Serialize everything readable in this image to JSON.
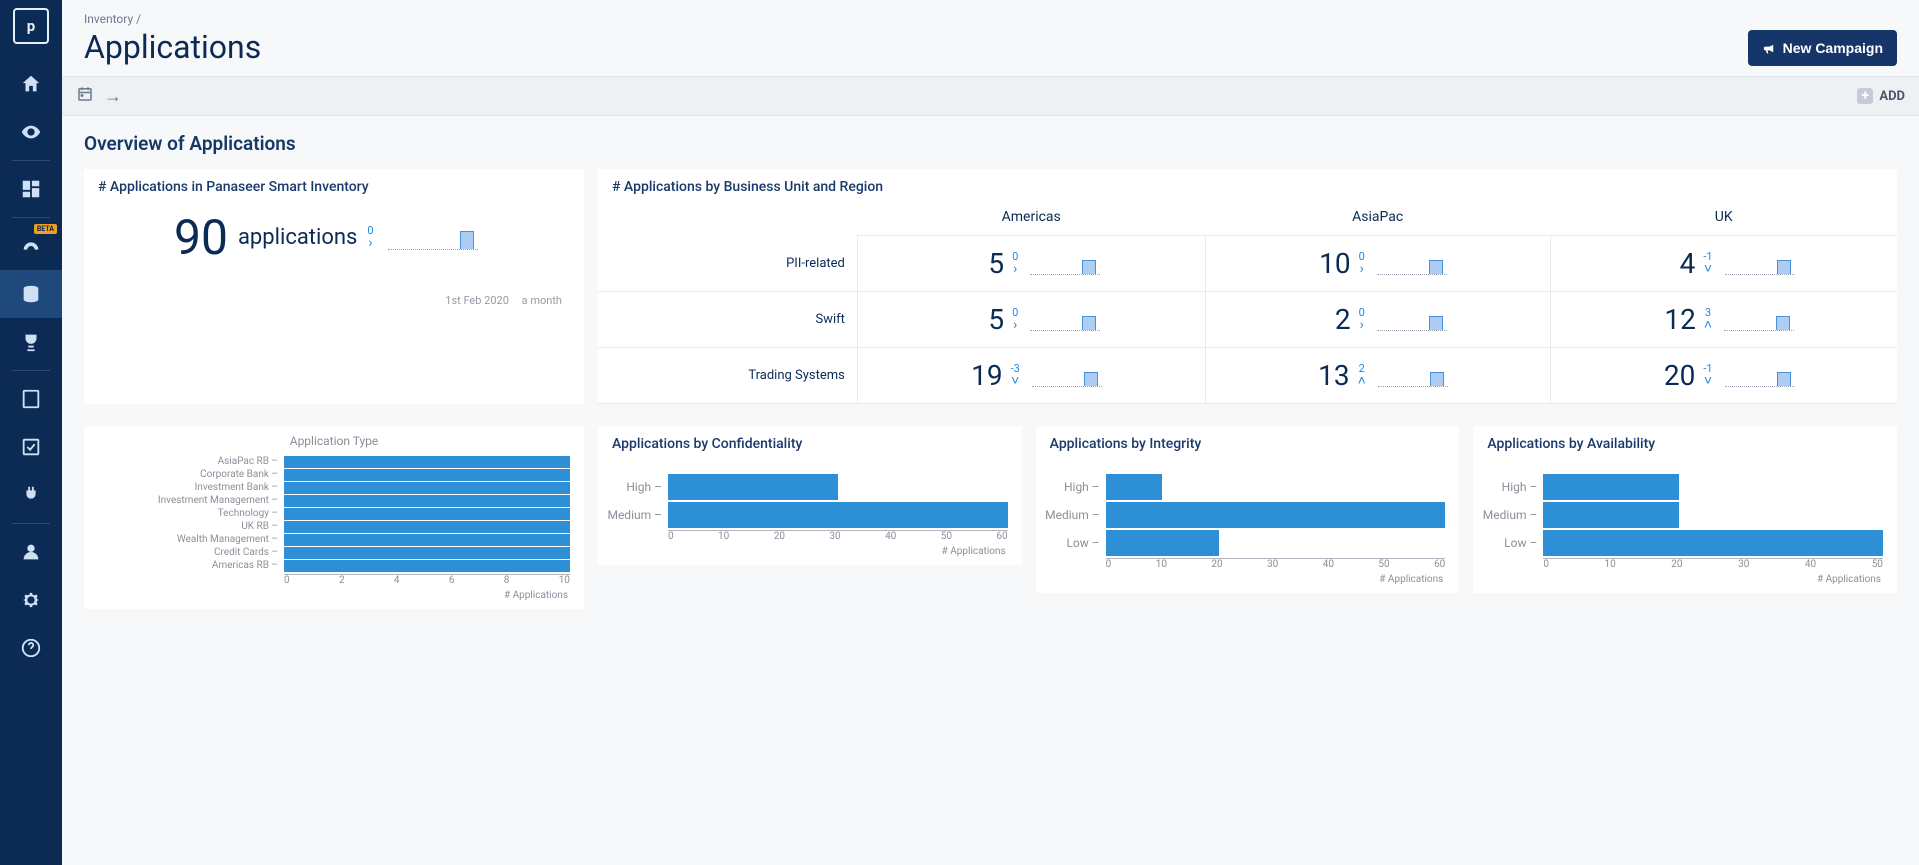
{
  "breadcrumb": "Inventory /",
  "page_title": "Applications",
  "new_campaign_label": "New Campaign",
  "toolbar": {
    "add_label": "ADD"
  },
  "section_title": "Overview of Applications",
  "metric_card": {
    "title": "# Applications in Panaseer Smart Inventory",
    "value": "90",
    "unit": "applications",
    "delta": "0",
    "footer_date": "1st Feb 2020",
    "footer_range": "a month"
  },
  "matrix_card": {
    "title": "# Applications by Business Unit and Region",
    "cols": [
      "Americas",
      "AsiaPac",
      "UK"
    ],
    "rows": [
      {
        "label": "PII-related",
        "cells": [
          {
            "val": "5",
            "delta": "0",
            "dir": "flat"
          },
          {
            "val": "10",
            "delta": "0",
            "dir": "flat"
          },
          {
            "val": "4",
            "delta": "-1",
            "dir": "down"
          }
        ]
      },
      {
        "label": "Swift",
        "cells": [
          {
            "val": "5",
            "delta": "0",
            "dir": "flat"
          },
          {
            "val": "2",
            "delta": "0",
            "dir": "flat"
          },
          {
            "val": "12",
            "delta": "3",
            "dir": "up"
          }
        ]
      },
      {
        "label": "Trading Systems",
        "cells": [
          {
            "val": "19",
            "delta": "-3",
            "dir": "down"
          },
          {
            "val": "13",
            "delta": "2",
            "dir": "up"
          },
          {
            "val": "20",
            "delta": "-1",
            "dir": "down"
          }
        ]
      }
    ]
  },
  "apptype_chart": {
    "title": "Application Type",
    "xlabel": "# Applications",
    "categories": [
      "AsiaPac RB",
      "Corporate Bank",
      "Investment Bank",
      "Investment Management",
      "Technology",
      "UK RB",
      "Wealth Management",
      "Credit Cards",
      "Americas RB"
    ]
  },
  "cia_charts": [
    {
      "title": "Applications by Confidentiality",
      "xlabel": "# Applications",
      "categories": [
        "High",
        "Medium"
      ],
      "values": [
        30,
        60
      ],
      "xmax": 60,
      "ticks": [
        "0",
        "10",
        "20",
        "30",
        "40",
        "50",
        "60"
      ]
    },
    {
      "title": "Applications by Integrity",
      "xlabel": "# Applications",
      "categories": [
        "High",
        "Medium",
        "Low"
      ],
      "values": [
        10,
        60,
        20
      ],
      "xmax": 60,
      "ticks": [
        "0",
        "10",
        "20",
        "30",
        "40",
        "50",
        "60"
      ]
    },
    {
      "title": "Applications by Availability",
      "xlabel": "# Applications",
      "categories": [
        "High",
        "Medium",
        "Low"
      ],
      "values": [
        20,
        20,
        50
      ],
      "xmax": 50,
      "ticks": [
        "0",
        "10",
        "20",
        "30",
        "40",
        "50"
      ]
    }
  ],
  "chart_data": [
    {
      "type": "bar",
      "orientation": "horizontal",
      "title": "Application Type",
      "xlabel": "# Applications",
      "ylabel": "",
      "categories": [
        "AsiaPac RB",
        "Corporate Bank",
        "Investment Bank",
        "Investment Management",
        "Technology",
        "UK RB",
        "Wealth Management",
        "Credit Cards",
        "Americas RB"
      ],
      "values": [
        10,
        10,
        10,
        10,
        10,
        10,
        10,
        10,
        10
      ],
      "xlim": [
        0,
        10
      ]
    },
    {
      "type": "bar",
      "orientation": "horizontal",
      "title": "Applications by Confidentiality",
      "xlabel": "# Applications",
      "categories": [
        "High",
        "Medium"
      ],
      "values": [
        30,
        60
      ],
      "xlim": [
        0,
        60
      ]
    },
    {
      "type": "bar",
      "orientation": "horizontal",
      "title": "Applications by Integrity",
      "xlabel": "# Applications",
      "categories": [
        "High",
        "Medium",
        "Low"
      ],
      "values": [
        10,
        60,
        20
      ],
      "xlim": [
        0,
        60
      ]
    },
    {
      "type": "bar",
      "orientation": "horizontal",
      "title": "Applications by Availability",
      "xlabel": "# Applications",
      "categories": [
        "High",
        "Medium",
        "Low"
      ],
      "values": [
        20,
        20,
        50
      ],
      "xlim": [
        0,
        50
      ]
    }
  ]
}
